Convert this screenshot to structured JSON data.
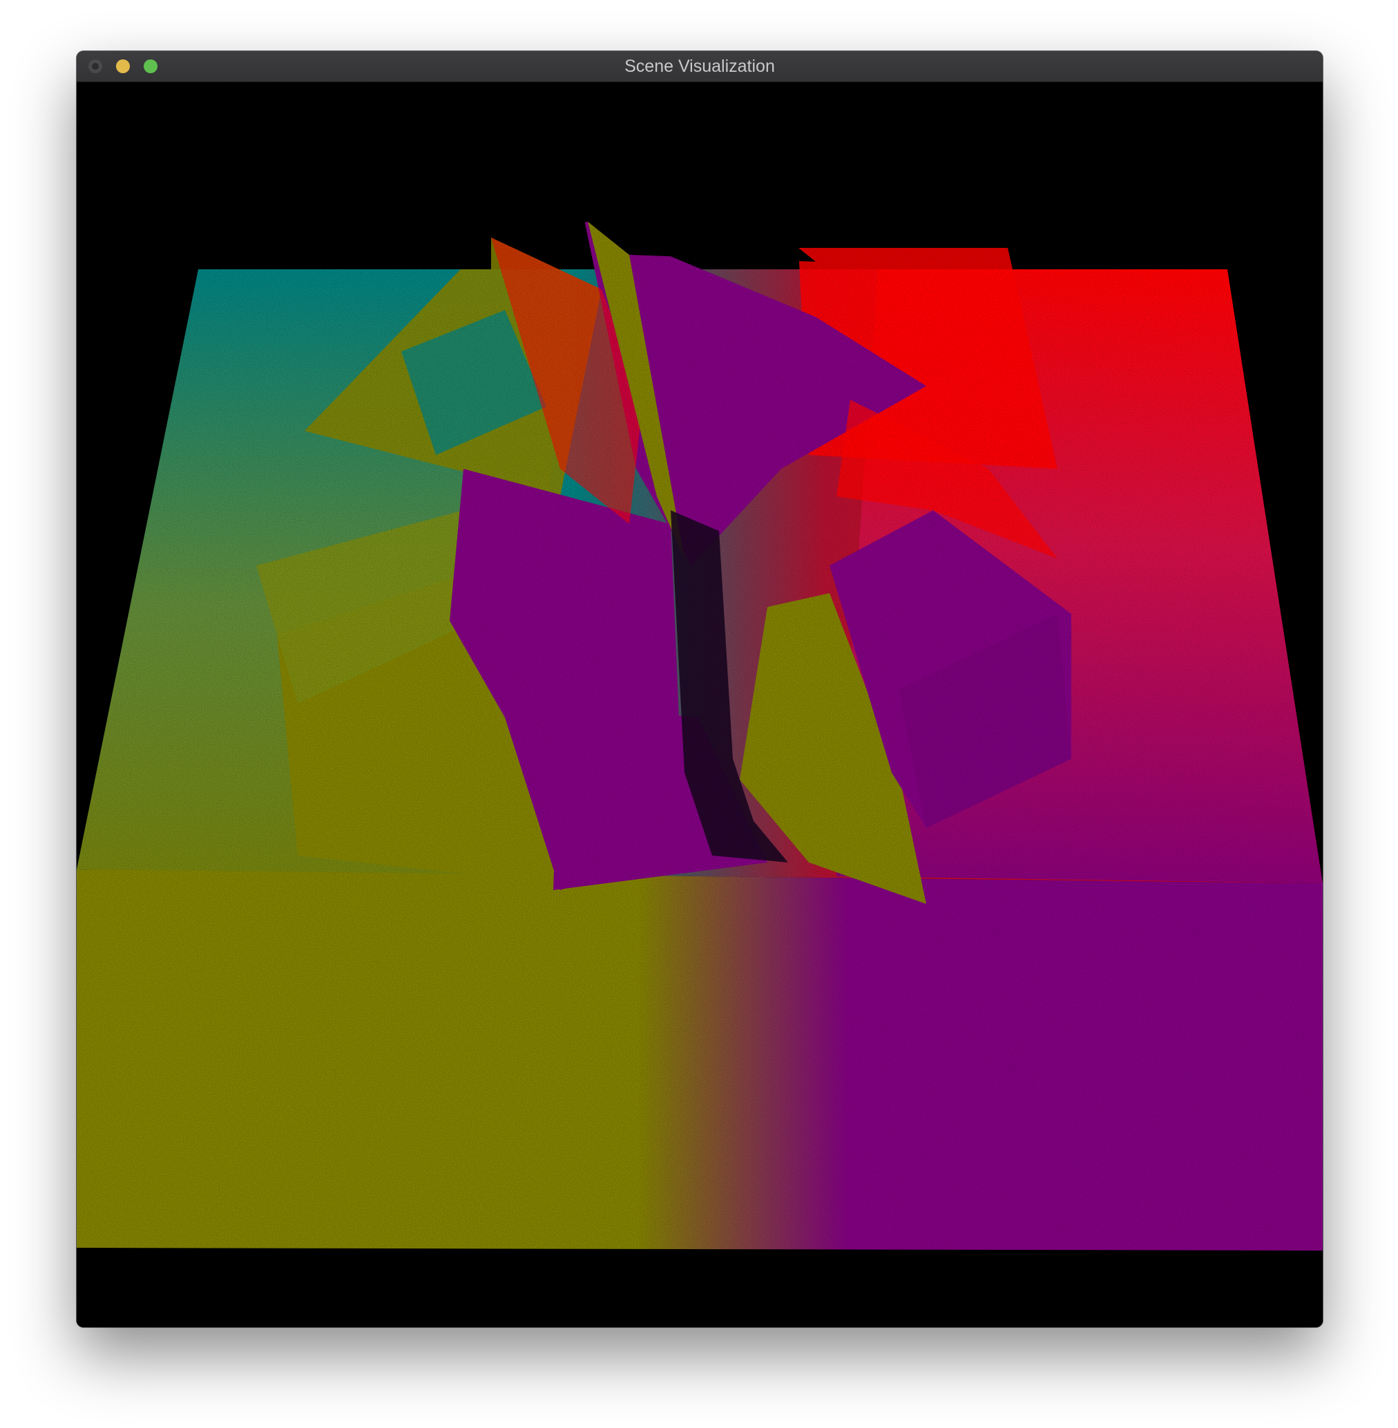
{
  "window": {
    "title": "Scene Visualization",
    "controls": {
      "close": "close-button",
      "minimize": "minimize-button",
      "zoom": "zoom-button"
    }
  },
  "scene": {
    "background": "#000000",
    "palette": {
      "teal": "#008080",
      "olive": "#808000",
      "purple": "#800080",
      "red": "#ff0000",
      "green": "#008000",
      "navy": "#000080"
    }
  }
}
